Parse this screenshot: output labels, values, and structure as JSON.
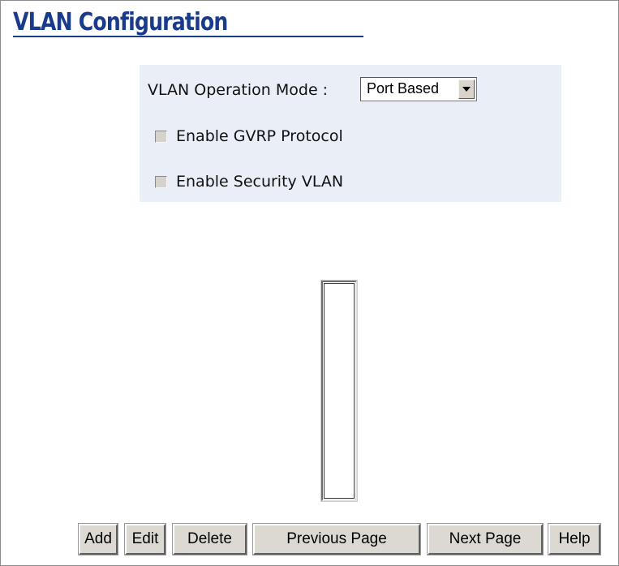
{
  "page": {
    "title": "VLAN Configuration"
  },
  "settings": {
    "operation_mode_label": "VLAN Operation Mode :",
    "operation_mode_value": "Port Based",
    "gvrp_label": "Enable GVRP Protocol",
    "gvrp_checked": false,
    "security_vlan_label": "Enable Security VLAN",
    "security_vlan_checked": false
  },
  "vlan_list": {
    "items": []
  },
  "buttons": {
    "add": "Add",
    "edit": "Edit",
    "delete": "Delete",
    "previous_page": "Previous Page",
    "next_page": "Next Page",
    "help": "Help"
  },
  "colors": {
    "title": "#1a3b8c",
    "panel_background": "#e9eef7",
    "button_face": "#dcd9d2"
  }
}
